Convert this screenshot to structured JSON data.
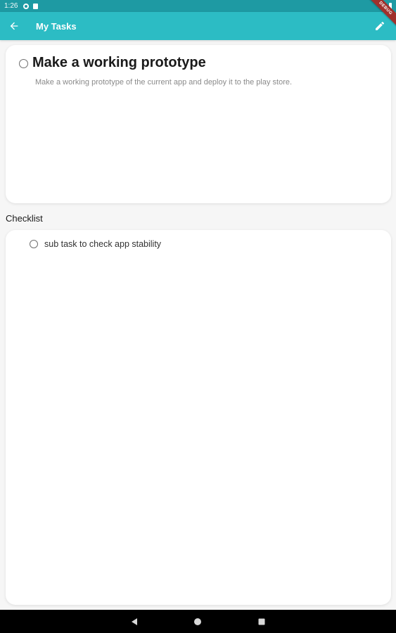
{
  "status_bar": {
    "time": "1:26"
  },
  "app_bar": {
    "title": "My Tasks",
    "back_icon": "arrow-left-icon",
    "edit_icon": "pencil-icon"
  },
  "debug_banner": {
    "label": "DEBUG"
  },
  "task": {
    "title": "Make a working prototype",
    "description": "Make a working prototype of the current app and deploy it to the play store.",
    "completed": false
  },
  "checklist": {
    "label": "Checklist",
    "items": [
      {
        "label": "sub task to check app stability",
        "completed": false
      }
    ]
  },
  "nav_bar": {
    "icons": [
      "back-triangle-icon",
      "home-circle-icon",
      "recents-square-icon"
    ]
  },
  "colors": {
    "app_bar": "#2cbcc4",
    "status_bar": "#1e9aa3",
    "background": "#f6f6f6",
    "card": "#ffffff",
    "banner": "#a0302b"
  }
}
